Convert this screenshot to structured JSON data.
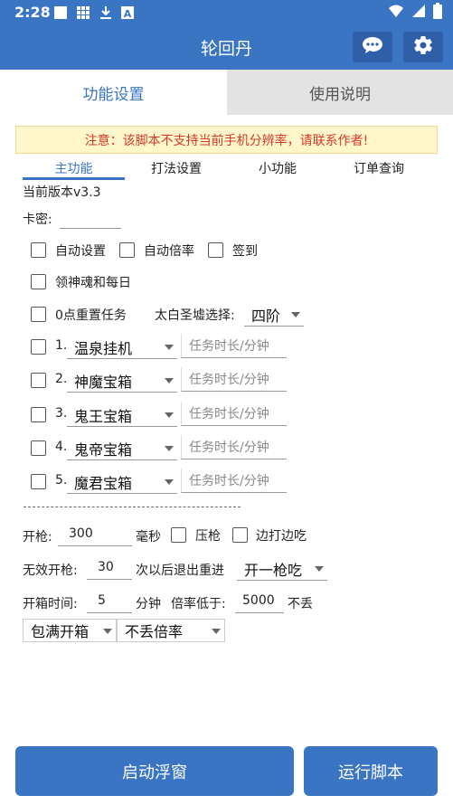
{
  "status_bar": {
    "time": "2:28",
    "icons": [
      "notification-square-icon",
      "grid-icon",
      "download-icon",
      "a-icon",
      "wifi-icon",
      "signal-icon",
      "battery-icon"
    ]
  },
  "app": {
    "title": "轮回丹"
  },
  "header_buttons": [
    "chat-icon",
    "gear-icon"
  ],
  "tabs": [
    {
      "label": "功能设置",
      "active": true
    },
    {
      "label": "使用说明",
      "active": false
    }
  ],
  "warning": "注意：该脚本不支持当前手机分辨率，请联系作者!",
  "subtabs": [
    {
      "label": "主功能",
      "active": true
    },
    {
      "label": "打法设置",
      "active": false
    },
    {
      "label": "小功能",
      "active": false
    },
    {
      "label": "订单查询",
      "active": false
    }
  ],
  "version": "当前版本v3.3",
  "card": {
    "label": "卡密:",
    "value": ""
  },
  "checkboxes": {
    "auto_settings": "自动设置",
    "auto_multiplier": "自动倍率",
    "sign_in": "签到",
    "soul_daily": "领神魂和每日",
    "reset_task": "0点重置任务"
  },
  "taibai": {
    "label": "太白圣墟选择:",
    "value": "四阶"
  },
  "tasks": [
    {
      "num": "1.",
      "value": "温泉挂机",
      "placeholder": "任务时长/分钟"
    },
    {
      "num": "2.",
      "value": "神魔宝箱",
      "placeholder": "任务时长/分钟"
    },
    {
      "num": "3.",
      "value": "鬼王宝箱",
      "placeholder": "任务时长/分钟"
    },
    {
      "num": "4.",
      "value": "鬼帝宝箱",
      "placeholder": "任务时长/分钟"
    },
    {
      "num": "5.",
      "value": "魔君宝箱",
      "placeholder": "任务时长/分钟"
    }
  ],
  "fire": {
    "label": "开枪:",
    "value": "300",
    "unit": "毫秒",
    "press_gun": "压枪",
    "shoot_eat": "边打边吃"
  },
  "invalid_fire": {
    "label": "无效开枪:",
    "value": "30",
    "suffix": "次以后退出重进",
    "select": "开一枪吃"
  },
  "box_time": {
    "label": "开箱时间:",
    "value": "5",
    "unit": "分钟",
    "mult_label": "倍率低于:",
    "mult_value": "5000",
    "mult_suffix": "不丢"
  },
  "box_selects": [
    "包满开箱",
    "不丢倍率"
  ],
  "buttons": {
    "float_window": "启动浮窗",
    "run_script": "运行脚本"
  },
  "colors": {
    "primary": "#3a75c4",
    "warning_text": "#d43a2a",
    "warning_bg": "#fff6cc"
  }
}
